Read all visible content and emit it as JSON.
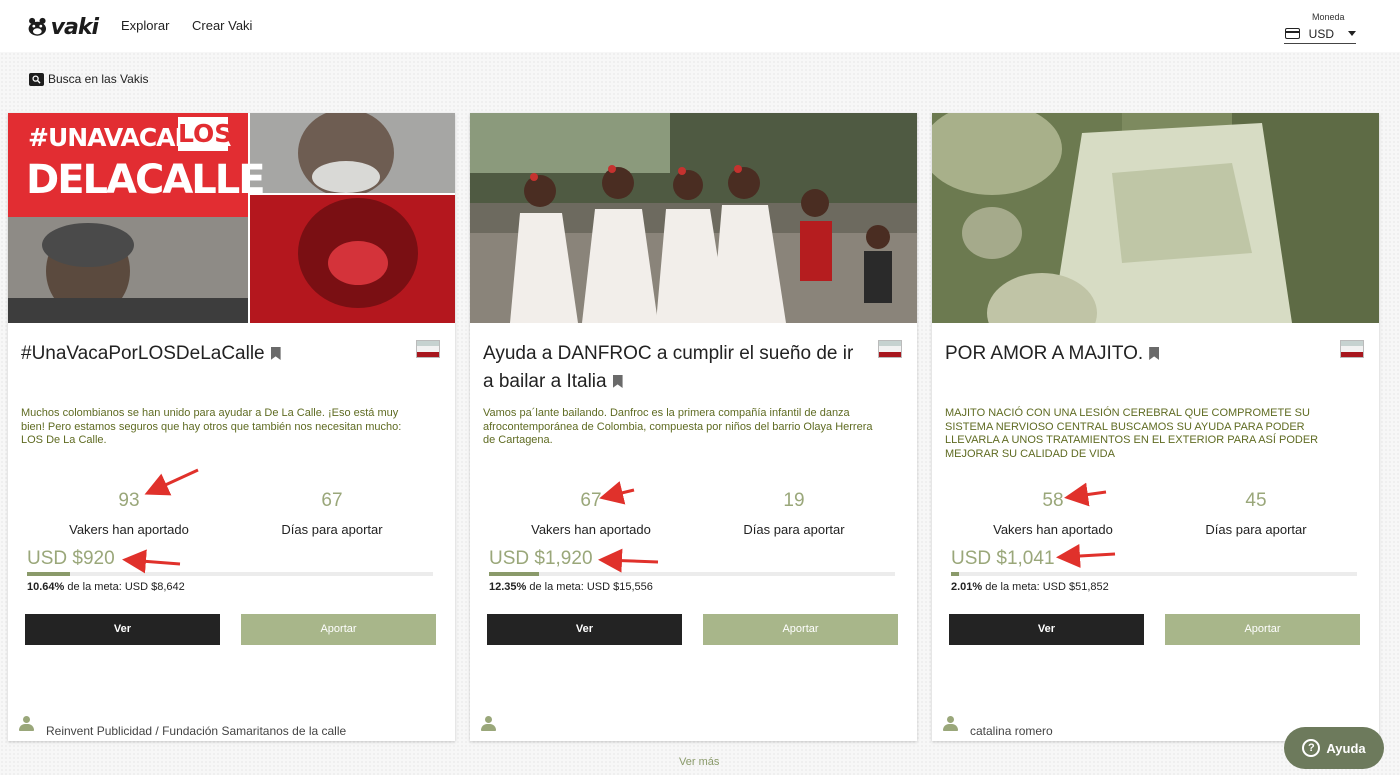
{
  "header": {
    "logo_text": "vaki",
    "nav": [
      "Explorar",
      "Crear Vaki"
    ],
    "currency_label": "Moneda",
    "currency_value": "USD"
  },
  "search": {
    "label": "Busca en las Vakis"
  },
  "colors": {
    "accent": "#9aa77a",
    "button_dark": "#232323",
    "button_light": "#a8b68a",
    "annotation_arrow": "#e0312b"
  },
  "cards": [
    {
      "image_text_1": "#UNAVACAPOR",
      "image_text_2": "LOS",
      "image_text_3": "DELACALLE",
      "title": "#UnaVacaPorLOSDeLaCalle",
      "description": "Muchos colombianos se han unido para ayudar a De La Calle. ¡Eso está muy bien! Pero estamos seguros que hay otros que también nos necesitan mucho: LOS De La Calle.",
      "vakers": "93",
      "vakers_label": "Vakers han aportado",
      "days": "67",
      "days_label": "Días para aportar",
      "raised": "USD $920",
      "progress_pct": 10.64,
      "progress_text": "10.64%",
      "goal_text": " de la meta: USD $8,642",
      "ver_label": "Ver",
      "aportar_label": "Aportar",
      "owner": "Reinvent Publicidad / Fundación Samaritanos de la calle"
    },
    {
      "title": "Ayuda a DANFROC a cumplir el sueño de ir a bailar a Italia",
      "description": "Vamos pa´lante bailando. Danfroc es la primera compañía infantil de danza afrocontemporánea de Colombia, compuesta por niños del barrio Olaya Herrera de Cartagena.",
      "vakers": "67",
      "vakers_label": "Vakers han aportado",
      "days": "19",
      "days_label": "Días para aportar",
      "raised": "USD $1,920",
      "progress_pct": 12.35,
      "progress_text": "12.35%",
      "goal_text": " de la meta: USD $15,556",
      "ver_label": "Ver",
      "aportar_label": "Aportar",
      "owner": ""
    },
    {
      "title": "POR AMOR A MAJITO.",
      "description": "MAJITO NACIÓ CON UNA LESIÓN CEREBRAL QUE COMPROMETE SU SISTEMA NERVIOSO CENTRAL BUSCAMOS SU AYUDA PARA PODER LLEVARLA A UNOS TRATAMIENTOS EN EL EXTERIOR PARA ASÍ PODER MEJORAR SU CALIDAD DE VIDA",
      "vakers": "58",
      "vakers_label": "Vakers han aportado",
      "days": "45",
      "days_label": "Días para aportar",
      "raised": "USD $1,041",
      "progress_pct": 2.01,
      "progress_text": "2.01%",
      "goal_text": " de la meta: USD $51,852",
      "ver_label": "Ver",
      "aportar_label": "Aportar",
      "owner": "catalina romero"
    }
  ],
  "footer": {
    "ver_mas": "Ver más",
    "help_label": "Ayuda",
    "help_icon": "?"
  }
}
